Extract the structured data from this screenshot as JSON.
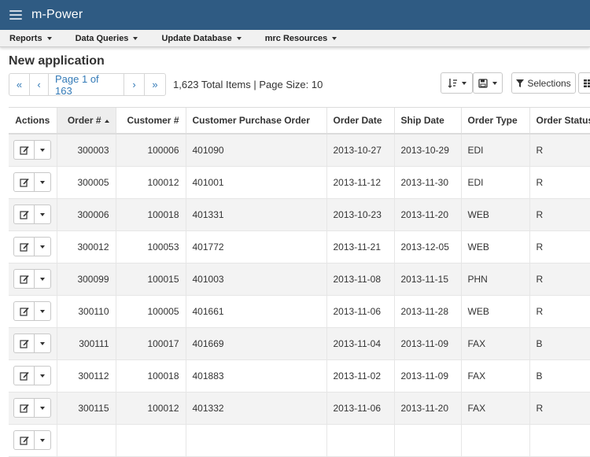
{
  "app": {
    "name": "m-Power"
  },
  "menu": [
    {
      "label": "Reports"
    },
    {
      "label": "Data Queries"
    },
    {
      "label": "Update Database"
    },
    {
      "label": "mrc Resources"
    }
  ],
  "page_title": "New application",
  "pager": {
    "first": "«",
    "prev": "‹",
    "page_label": "Page 1 of 163",
    "next": "›",
    "last": "»"
  },
  "totals": "1,623 Total Items | Page Size: 10",
  "toolbar": {
    "selections_label": "Selections"
  },
  "columns": [
    "Actions",
    "Order #",
    "Customer #",
    "Customer Purchase Order",
    "Order Date",
    "Ship Date",
    "Order Type",
    "Order Status"
  ],
  "rows": [
    {
      "order": "300003",
      "customer": "100006",
      "po": "401090",
      "order_date": "2013-10-27",
      "ship_date": "2013-10-29",
      "type": "EDI",
      "status": "R"
    },
    {
      "order": "300005",
      "customer": "100012",
      "po": "401001",
      "order_date": "2013-11-12",
      "ship_date": "2013-11-30",
      "type": "EDI",
      "status": "R"
    },
    {
      "order": "300006",
      "customer": "100018",
      "po": "401331",
      "order_date": "2013-10-23",
      "ship_date": "2013-11-20",
      "type": "WEB",
      "status": "R"
    },
    {
      "order": "300012",
      "customer": "100053",
      "po": "401772",
      "order_date": "2013-11-21",
      "ship_date": "2013-12-05",
      "type": "WEB",
      "status": "R"
    },
    {
      "order": "300099",
      "customer": "100015",
      "po": "401003",
      "order_date": "2013-11-08",
      "ship_date": "2013-11-15",
      "type": "PHN",
      "status": "R"
    },
    {
      "order": "300110",
      "customer": "100005",
      "po": "401661",
      "order_date": "2013-11-06",
      "ship_date": "2013-11-28",
      "type": "WEB",
      "status": "R"
    },
    {
      "order": "300111",
      "customer": "100017",
      "po": "401669",
      "order_date": "2013-11-04",
      "ship_date": "2013-11-09",
      "type": "FAX",
      "status": "B"
    },
    {
      "order": "300112",
      "customer": "100018",
      "po": "401883",
      "order_date": "2013-11-02",
      "ship_date": "2013-11-09",
      "type": "FAX",
      "status": "B"
    },
    {
      "order": "300115",
      "customer": "100012",
      "po": "401332",
      "order_date": "2013-11-06",
      "ship_date": "2013-11-20",
      "type": "FAX",
      "status": "R"
    },
    {
      "order": "",
      "customer": "",
      "po": "",
      "order_date": "",
      "ship_date": "",
      "type": "",
      "status": ""
    }
  ]
}
